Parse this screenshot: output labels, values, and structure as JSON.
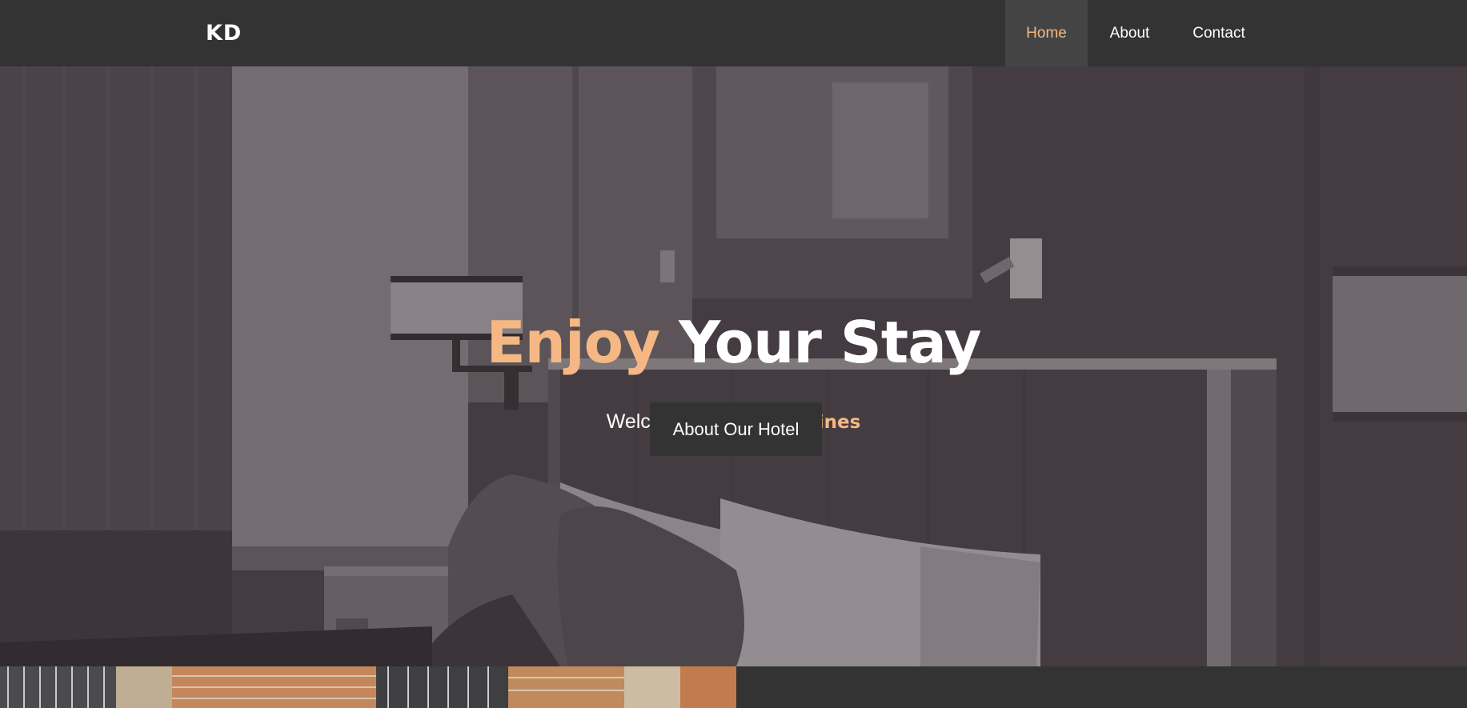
{
  "brand": {
    "logo": "KD"
  },
  "nav": {
    "items": [
      {
        "label": "Home",
        "active": true
      },
      {
        "label": "About",
        "active": false
      },
      {
        "label": "Contact",
        "active": false
      }
    ]
  },
  "hero": {
    "title_accent": "Enjoy",
    "title_rest": " Your Stay",
    "subtitle_prefix": "Welcome to ",
    "subtitle_highlight": "Kolkata Dines",
    "button_label": "About Our Hotel"
  },
  "colors": {
    "accent": "#f5b884",
    "navbar": "#333333",
    "active_nav_bg": "#444444",
    "button_bg": "#333333"
  }
}
